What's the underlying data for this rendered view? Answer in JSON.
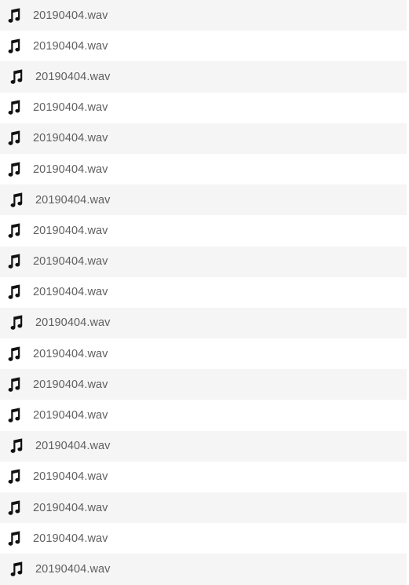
{
  "file_list": {
    "items": [
      {
        "name": "20190404.wav",
        "icon": "music-note-icon"
      },
      {
        "name": "20190404.wav",
        "icon": "music-note-icon"
      },
      {
        "name": "20190404.wav",
        "icon": "music-note-icon"
      },
      {
        "name": "20190404.wav",
        "icon": "music-note-icon"
      },
      {
        "name": "20190404.wav",
        "icon": "music-note-icon"
      },
      {
        "name": "20190404.wav",
        "icon": "music-note-icon"
      },
      {
        "name": "20190404.wav",
        "icon": "music-note-icon"
      },
      {
        "name": "20190404.wav",
        "icon": "music-note-icon"
      },
      {
        "name": "20190404.wav",
        "icon": "music-note-icon"
      },
      {
        "name": "20190404.wav",
        "icon": "music-note-icon"
      },
      {
        "name": "20190404.wav",
        "icon": "music-note-icon"
      },
      {
        "name": "20190404.wav",
        "icon": "music-note-icon"
      },
      {
        "name": "20190404.wav",
        "icon": "music-note-icon"
      },
      {
        "name": "20190404.wav",
        "icon": "music-note-icon"
      },
      {
        "name": "20190404.wav",
        "icon": "music-note-icon"
      },
      {
        "name": "20190404.wav",
        "icon": "music-note-icon"
      },
      {
        "name": "20190404.wav",
        "icon": "music-note-icon"
      },
      {
        "name": "20190404.wav",
        "icon": "music-note-icon"
      },
      {
        "name": "20190404.wav",
        "icon": "music-note-icon"
      }
    ]
  },
  "colors": {
    "row_alt_bg": "#f5f5f5",
    "row_bg": "#ffffff",
    "text": "#5f5f5f",
    "icon": "#111111"
  }
}
